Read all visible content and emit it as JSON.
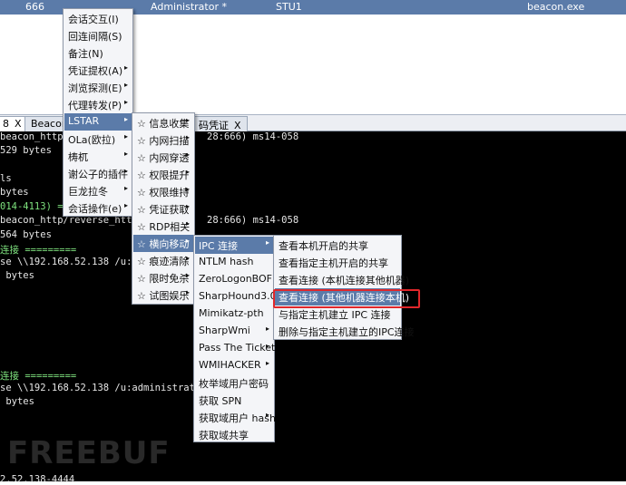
{
  "session": {
    "pid": "666",
    "user": "Administrator *",
    "computer": "STU1",
    "process": "beacon.exe"
  },
  "tabs": [
    {
      "label": "8",
      "close": "X"
    },
    {
      "label": "Beacon",
      "close": ""
    },
    {
      "label": "码凭证",
      "close": "X"
    }
  ],
  "console_lines": [
    "beacon_http/r",
    "529 bytes",
    "ls",
    "bytes",
    "014-4113) ====",
    "beacon_http/reverse_http",
    "564 bytes",
    "连接 =========",
    "se \\\\192.168.52.138 /u:adm",
    " bytes",
    "连接 =========",
    "se \\\\192.168.52.138 /u:administrator he",
    " bytes",
    "2.52.138-4444"
  ],
  "console_fragments": {
    "l1": "28:666) ms14-058",
    "l2": "28:666) ms14-058"
  },
  "menu_main": [
    {
      "label": "会话交互(I)",
      "sub": false
    },
    {
      "label": "回连间隔(S)",
      "sub": false
    },
    {
      "label": "备注(N)",
      "sub": false
    },
    {
      "label": "凭证提权(A)",
      "sub": true
    },
    {
      "label": "浏览探测(E)",
      "sub": true
    },
    {
      "label": "代理转发(P)",
      "sub": true
    },
    {
      "label": "LSTAR",
      "sub": true
    },
    {
      "label": "OLa(欧拉)",
      "sub": true
    },
    {
      "label": "梼杌",
      "sub": true
    },
    {
      "label": "谢公子的插件",
      "sub": true
    },
    {
      "label": "巨龙拉冬",
      "sub": true
    },
    {
      "label": "会话操作(e)",
      "sub": true
    }
  ],
  "menu_lstar": [
    {
      "label": "☆ 信息收集",
      "sub": true
    },
    {
      "label": "☆ 内网扫描",
      "sub": true
    },
    {
      "label": "☆ 内网穿透",
      "sub": true
    },
    {
      "label": "☆ 权限提升",
      "sub": true
    },
    {
      "label": "☆ 权限维持",
      "sub": true
    },
    {
      "label": "☆ 凭证获取",
      "sub": true
    },
    {
      "label": "☆ RDP相关",
      "sub": true
    },
    {
      "label": "☆ 横向移动",
      "sub": true
    },
    {
      "label": "☆ 痕迹清除",
      "sub": true
    },
    {
      "label": "☆ 限时免杀",
      "sub": true
    },
    {
      "label": "☆ 试图娱乐",
      "sub": true
    }
  ],
  "menu_lateral": [
    {
      "label": "IPC 连接",
      "sub": true
    },
    {
      "label": "NTLM hash",
      "sub": false
    },
    {
      "label": "ZeroLogonBOF",
      "sub": false
    },
    {
      "label": "SharpHound3.0",
      "sub": false
    },
    {
      "label": "Mimikatz-pth",
      "sub": false
    },
    {
      "label": "SharpWmi",
      "sub": true
    },
    {
      "label": "Pass The Ticket",
      "sub": true
    },
    {
      "label": "WMIHACKER",
      "sub": true
    },
    {
      "label": "枚举域用户密码",
      "sub": false
    },
    {
      "label": "获取 SPN",
      "sub": false
    },
    {
      "label": "获取域用户 hash",
      "sub": true
    },
    {
      "label": "获取域共享",
      "sub": false
    }
  ],
  "menu_ipc": [
    {
      "label": "查看本机开启的共享"
    },
    {
      "label": "查看指定主机开启的共享"
    },
    {
      "label": "查看连接 (本机连接其他机器)"
    },
    {
      "label": "查看连接 (其他机器连接本机)"
    },
    {
      "label": "与指定主机建立 IPC 连接"
    },
    {
      "label": "删除与指定主机建立的IPC连接"
    }
  ],
  "watermark": "FREEBUF",
  "arrow_glyph": "▸",
  "colors": {
    "highlight": "#5b7ba9",
    "annotation": "#e0272b",
    "console_bg": "#000000"
  }
}
